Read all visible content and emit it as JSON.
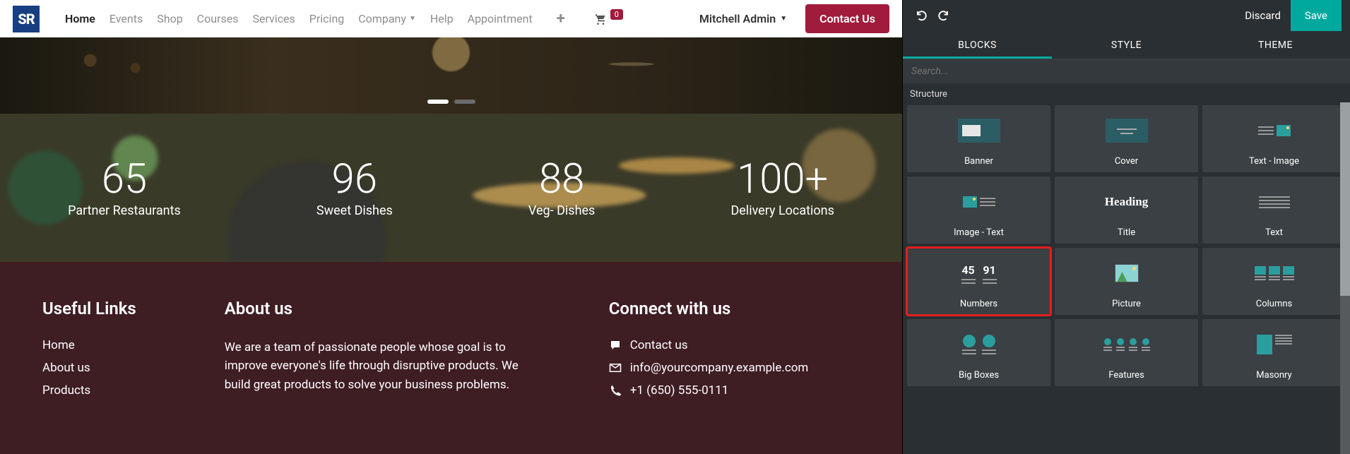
{
  "nav": {
    "items": [
      "Home",
      "Events",
      "Shop",
      "Courses",
      "Services",
      "Pricing",
      "Company",
      "Help",
      "Appointment"
    ],
    "active_index": 0,
    "cart_count": "0",
    "user": "Mitchell Admin",
    "contact_btn": "Contact Us"
  },
  "counters": [
    {
      "value": "65",
      "label": "Partner Restaurants"
    },
    {
      "value": "96",
      "label": "Sweet Dishes"
    },
    {
      "value": "88",
      "label": "Veg- Dishes"
    },
    {
      "value": "100+",
      "label": "Delivery Locations"
    }
  ],
  "footer": {
    "links_title": "Useful Links",
    "links": [
      "Home",
      "About us",
      "Products"
    ],
    "about_title": "About us",
    "about_text": "We are a team of passionate people whose goal is to improve everyone's life through disruptive products. We build great products to solve your business problems.",
    "connect_title": "Connect with us",
    "contact_label": "Contact us",
    "email": "info@yourcompany.example.com",
    "phone": "+1 (650) 555-0111"
  },
  "editor": {
    "discard": "Discard",
    "save": "Save",
    "tabs": [
      "BLOCKS",
      "STYLE",
      "THEME"
    ],
    "active_tab": 0,
    "search_placeholder": "Search...",
    "section": "Structure",
    "blocks": [
      "Banner",
      "Cover",
      "Text - Image",
      "Image - Text",
      "Title",
      "Text",
      "Numbers",
      "Picture",
      "Columns",
      "Big Boxes",
      "Features",
      "Masonry"
    ],
    "highlighted_block_index": 6,
    "numbers_thumb": [
      "45",
      "91"
    ]
  }
}
